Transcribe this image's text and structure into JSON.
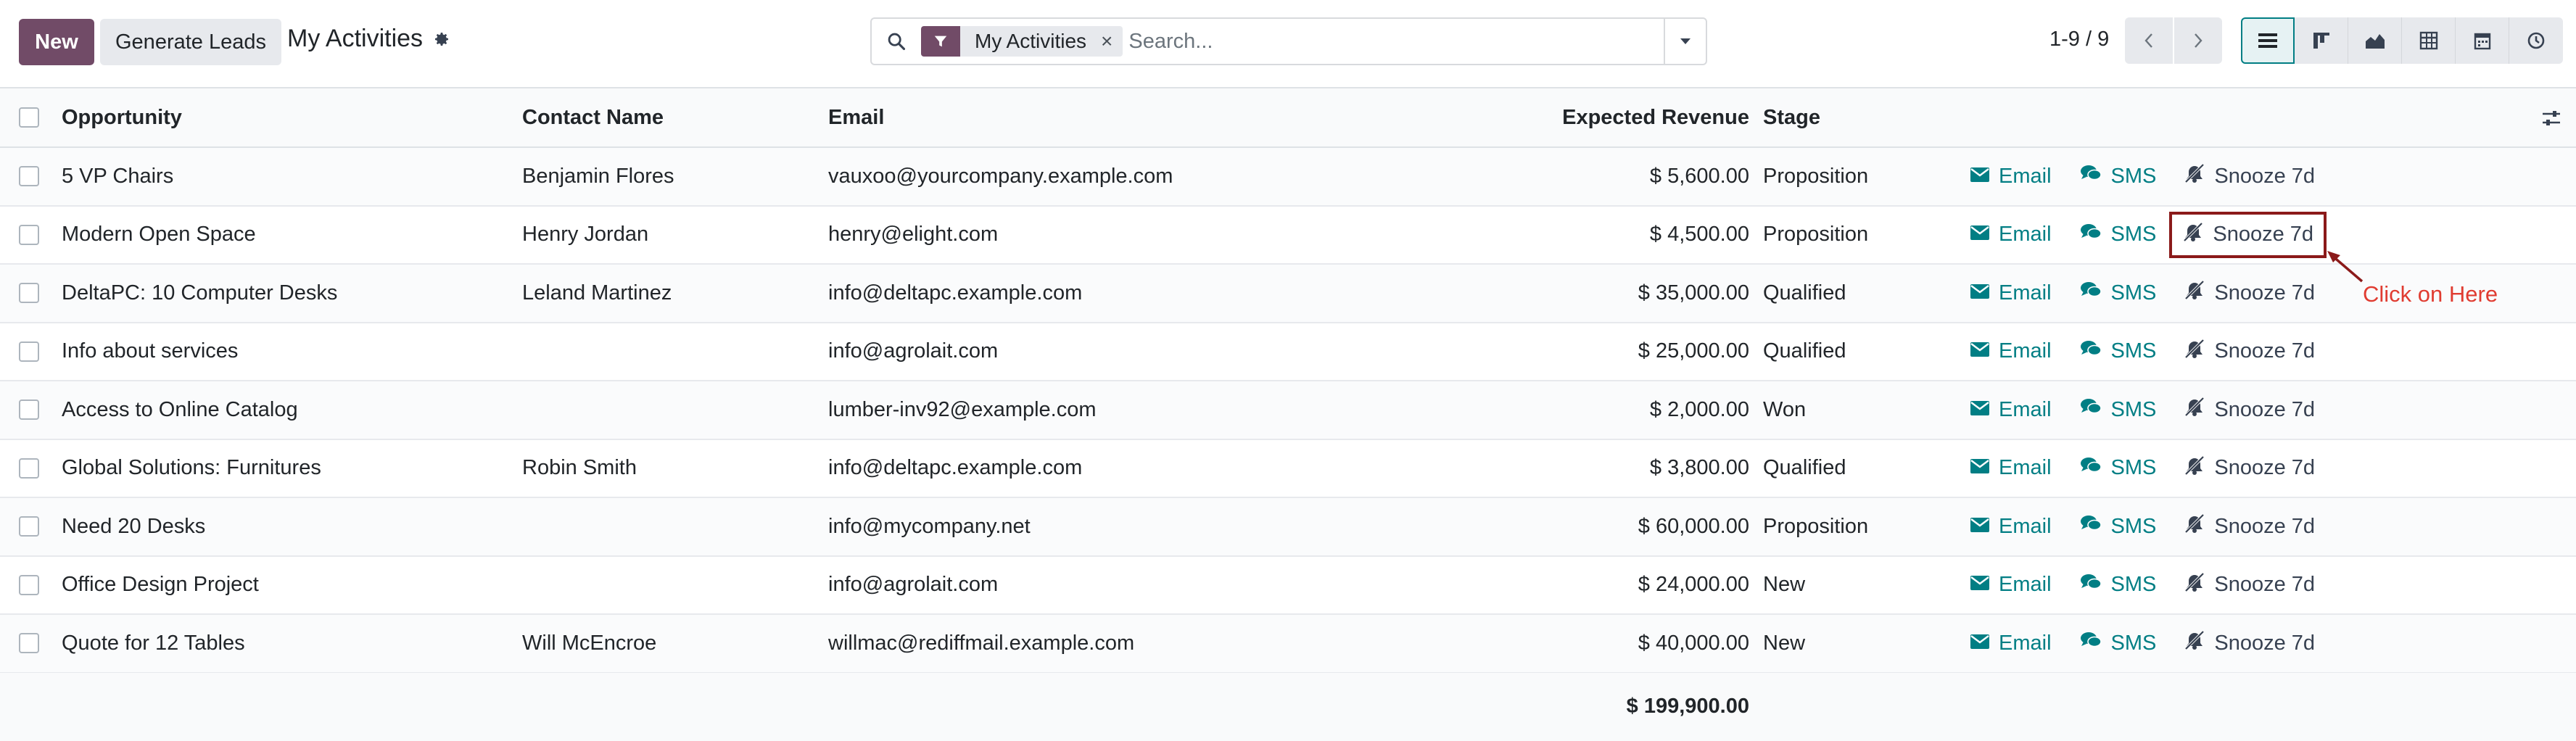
{
  "toolbar": {
    "new_label": "New",
    "generate_label": "Generate Leads",
    "title": "My Activities",
    "settings_icon": "gear-icon"
  },
  "search": {
    "facet_label": "My Activities",
    "facet_close": "×",
    "placeholder": "Search...",
    "facet_icon": "filter-icon"
  },
  "pager": {
    "value": "1-9 / 9"
  },
  "table": {
    "headers": {
      "opportunity": "Opportunity",
      "contact": "Contact Name",
      "email": "Email",
      "revenue": "Expected Revenue",
      "stage": "Stage"
    },
    "actions": {
      "email": "Email",
      "sms": "SMS",
      "snooze": "Snooze 7d"
    },
    "rows": [
      {
        "opportunity": "5 VP Chairs",
        "contact": "Benjamin Flores",
        "email": "vauxoo@yourcompany.example.com",
        "revenue": "$ 5,600.00",
        "stage": "Proposition"
      },
      {
        "opportunity": "Modern Open Space",
        "contact": "Henry Jordan",
        "email": "henry@elight.com",
        "revenue": "$ 4,500.00",
        "stage": "Proposition"
      },
      {
        "opportunity": "DeltaPC: 10 Computer Desks",
        "contact": "Leland Martinez",
        "email": "info@deltapc.example.com",
        "revenue": "$ 35,000.00",
        "stage": "Qualified"
      },
      {
        "opportunity": "Info about services",
        "contact": "",
        "email": "info@agrolait.com",
        "revenue": "$ 25,000.00",
        "stage": "Qualified"
      },
      {
        "opportunity": "Access to Online Catalog",
        "contact": "",
        "email": "lumber-inv92@example.com",
        "revenue": "$ 2,000.00",
        "stage": "Won"
      },
      {
        "opportunity": "Global Solutions: Furnitures",
        "contact": "Robin Smith",
        "email": "info@deltapc.example.com",
        "revenue": "$ 3,800.00",
        "stage": "Qualified"
      },
      {
        "opportunity": "Need 20 Desks",
        "contact": "",
        "email": "info@mycompany.net",
        "revenue": "$ 60,000.00",
        "stage": "Proposition"
      },
      {
        "opportunity": "Office Design Project",
        "contact": "",
        "email": "info@agrolait.com",
        "revenue": "$ 24,000.00",
        "stage": "New"
      },
      {
        "opportunity": "Quote for 12 Tables",
        "contact": "Will McEncroe",
        "email": "willmac@rediffmail.example.com",
        "revenue": "$ 40,000.00",
        "stage": "New"
      }
    ],
    "total": "$ 199,900.00"
  },
  "annotation": {
    "text": "Click on Here",
    "color": "#e03c31"
  },
  "colors": {
    "brand": "#714b67",
    "accent": "#017e84"
  }
}
